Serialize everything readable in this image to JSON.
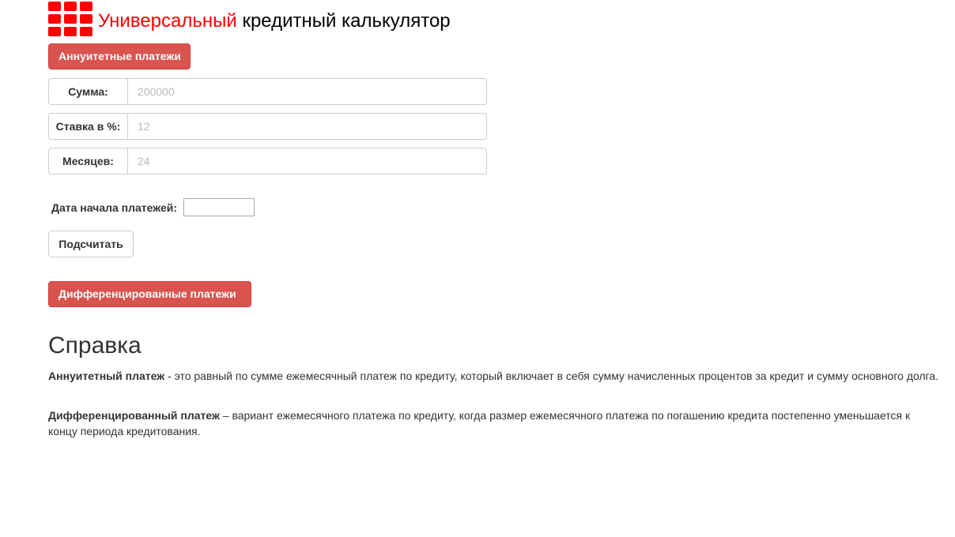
{
  "header": {
    "title_accent": "Универсальный",
    "title_rest": " кредитный калькулятор",
    "accent_color": "#ff0000",
    "logo_icon": "grid-logo-icon"
  },
  "annuity": {
    "button_label": "Аннуитетные платежи",
    "fields": [
      {
        "label": "Сумма:",
        "placeholder": "200000",
        "value": ""
      },
      {
        "label": "Ставка в %:",
        "placeholder": "12",
        "value": ""
      },
      {
        "label": "Месяцев:",
        "placeholder": "24",
        "value": ""
      }
    ],
    "date_label": "Дата начала платежей:",
    "date_value": "",
    "calculate_label": "Подсчитать"
  },
  "differentiated": {
    "button_label": "Дифференцированные платежи"
  },
  "help": {
    "title": "Справка",
    "annuity_term": "Аннуитетный платеж",
    "annuity_text": " - это равный по сумме ежемесячный платеж по кредиту, который включает в себя сумму начисленных процентов за кредит и сумму основного долга.",
    "diff_term": "Дифференцированный платеж",
    "diff_text": " – вариант ежемесячного платежа по кредиту, когда размер ежемесячного платежа по погашению кредита постепенно уменьшается к концу периода кредитования."
  },
  "colors": {
    "danger_button": "#d9534f",
    "text": "#333333"
  }
}
